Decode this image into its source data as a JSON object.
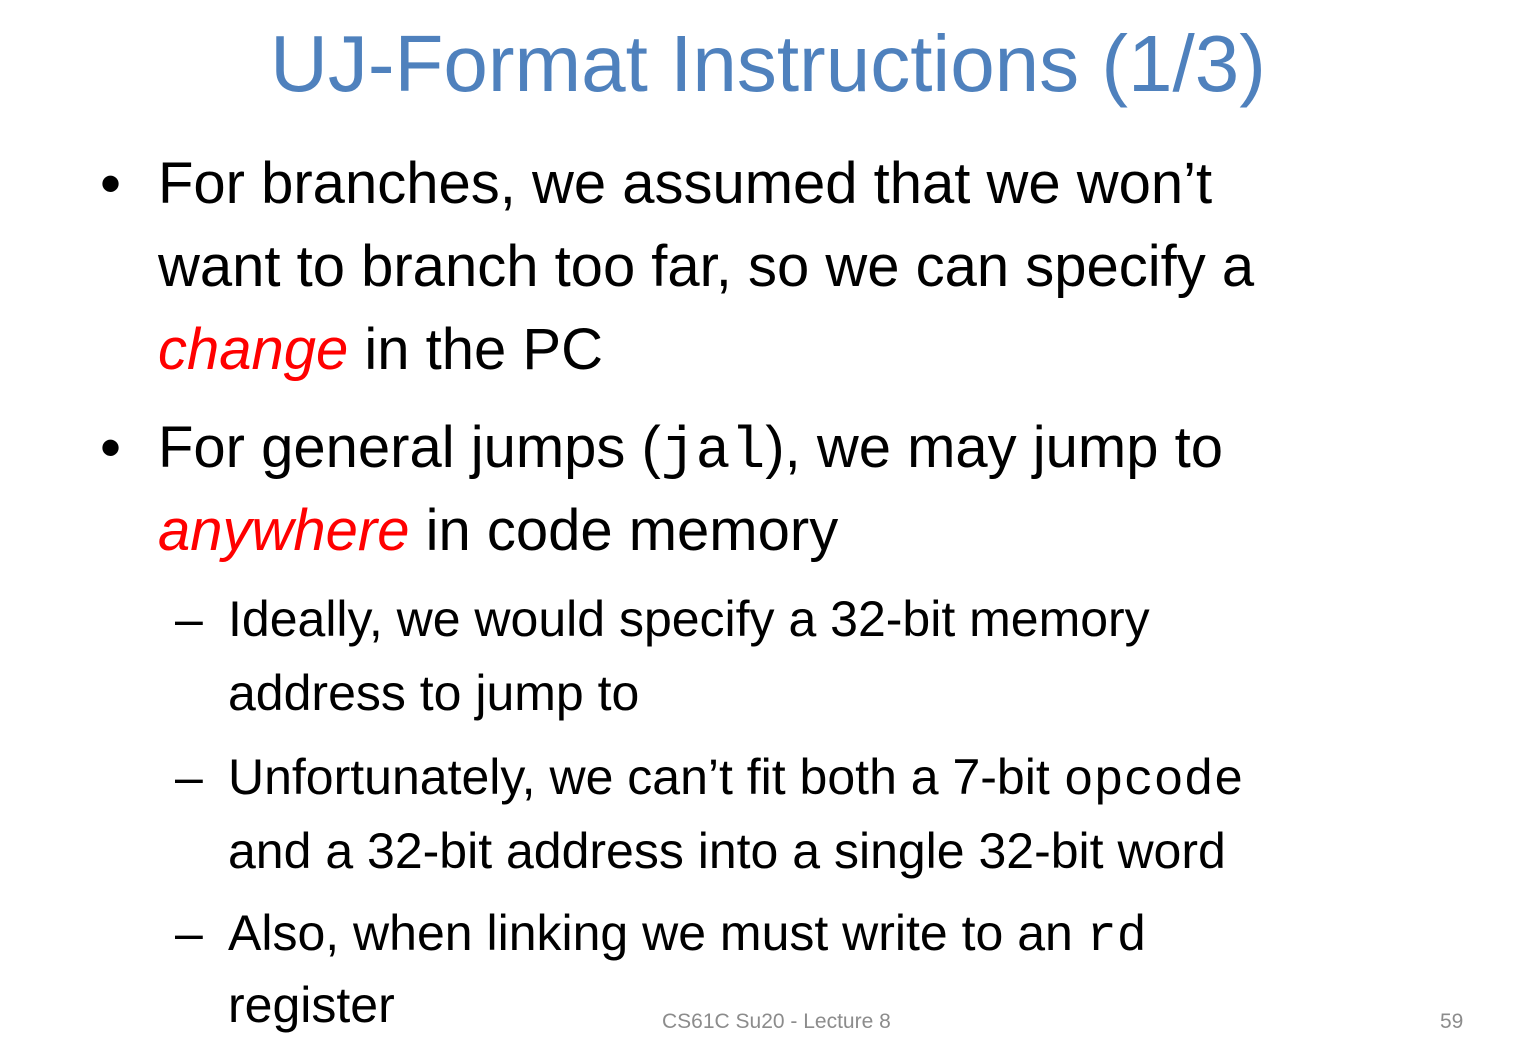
{
  "title": "UJ-Format Instructions (1/3)",
  "bullets": [
    {
      "lines": [
        {
          "text": "For branches, we assumed that we won’t"
        },
        {
          "text": "want to branch too far, so we can specify a"
        },
        {
          "em": "change",
          "rest": " in the PC"
        }
      ]
    },
    {
      "line1_before": "For general jumps (",
      "line1_code": "jal",
      "line1_after": "), we may jump to",
      "line2_em": "anywhere",
      "line2_rest": " in code memory"
    }
  ],
  "sub_bullets": [
    {
      "line1": "Ideally, we would specify a 32-bit memory",
      "line2": "address to jump to"
    },
    {
      "line1_before": "Unfortunately, we can’t fit both a 7-bit ",
      "line1_code": "opcode",
      "line2": "and a 32-bit address into a single 32-bit word"
    },
    {
      "line1_before": "Also, when linking we must write to an ",
      "line1_code": "rd",
      "line2": "register"
    }
  ],
  "footer": {
    "course": "CS61C Su20 - Lecture 8",
    "page": "59"
  },
  "colors": {
    "title": "#4f81bd",
    "emphasis": "#ff0000",
    "footer": "#8c8c8c"
  }
}
